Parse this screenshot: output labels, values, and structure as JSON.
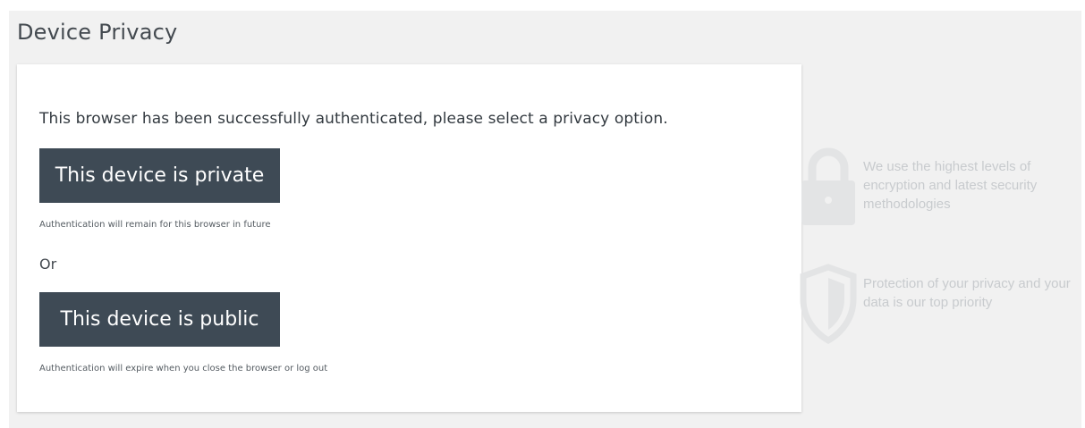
{
  "page": {
    "title": "Device Privacy"
  },
  "card": {
    "intro": "This browser has been successfully authenticated, please select a privacy option.",
    "private_button": "This device is private",
    "private_helper": "Authentication will remain for this browser in future",
    "or_label": "Or",
    "public_button": "This device is public",
    "public_helper": "Authentication will expire when you close the browser or log out"
  },
  "side": {
    "features": [
      {
        "icon": "lock-icon",
        "text": "We use the highest levels of encryption and latest security methodologies"
      },
      {
        "icon": "shield-icon",
        "text": "Protection of your privacy and your data is our top priority"
      }
    ]
  },
  "colors": {
    "button_bg": "#3e4a55",
    "page_bg": "#f1f1f1",
    "side_text": "#c8cbce"
  }
}
